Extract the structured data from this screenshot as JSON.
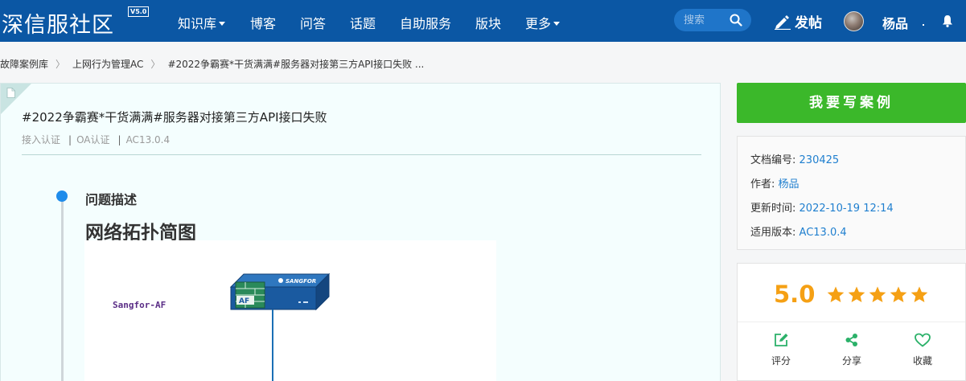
{
  "header": {
    "logo_text": "深信服社区",
    "logo_version": "V5.0",
    "nav": [
      "知识库",
      "博客",
      "问答",
      "话题",
      "自助服务",
      "版块",
      "更多"
    ],
    "search_placeholder": "搜索",
    "post_label": "发帖",
    "username": "杨品",
    "brand_color": "#0b57a4"
  },
  "breadcrumb": [
    "故障案例库",
    "上网行为管理AC",
    "#2022争霸赛*干货满满#服务器对接第三方API接口失败 ..."
  ],
  "article": {
    "title": "#2022争霸赛*干货满满#服务器对接第三方API接口失败",
    "tags": [
      "接入认证",
      "OA认证",
      "AC13.0.4"
    ],
    "section_label": "问题描述",
    "heading": "网络拓扑简图",
    "diagram": {
      "device_label": "Sangfor-AF",
      "device_brand": "SANGFOR",
      "device_badge": "AF"
    }
  },
  "sidebar": {
    "cta_label": "我要写案例",
    "cta_color": "#3bb82a",
    "info": [
      {
        "label": "文档编号:",
        "value": "230425"
      },
      {
        "label": "作者:",
        "value": "杨品"
      },
      {
        "label": "更新时间:",
        "value": "2022-10-19 12:14"
      },
      {
        "label": "适用版本:",
        "value": "AC13.0.4"
      }
    ],
    "rating": {
      "score": "5.0",
      "stars": 5,
      "max_stars": 5,
      "star_color": "#f5a014"
    },
    "actions": [
      {
        "label": "评分",
        "icon": "edit-icon"
      },
      {
        "label": "分享",
        "icon": "share-icon"
      },
      {
        "label": "收藏",
        "icon": "heart-icon"
      }
    ]
  }
}
